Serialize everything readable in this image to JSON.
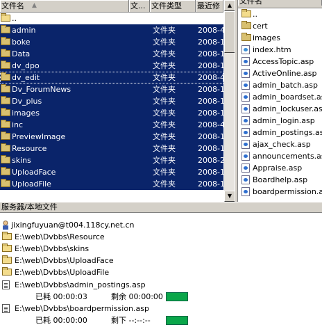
{
  "left_panel": {
    "columns": {
      "name": "文件名",
      "size": "文...",
      "type": "文件类型",
      "modified": "最近修"
    },
    "rows": [
      {
        "name": "..",
        "type": "",
        "date": "",
        "selected": false
      },
      {
        "name": "admin",
        "type": "文件夹",
        "date": "2008-4",
        "selected": true
      },
      {
        "name": "boke",
        "type": "文件夹",
        "date": "2008-1",
        "selected": true
      },
      {
        "name": "Data",
        "type": "文件夹",
        "date": "2008-1",
        "selected": true
      },
      {
        "name": "dv_dpo",
        "type": "文件夹",
        "date": "2008-1",
        "selected": true
      },
      {
        "name": "dv_edit",
        "type": "文件夹",
        "date": "2008-4",
        "selected": true
      },
      {
        "name": "Dv_ForumNews",
        "type": "文件夹",
        "date": "2008-1",
        "selected": true
      },
      {
        "name": "Dv_plus",
        "type": "文件夹",
        "date": "2008-1",
        "selected": true
      },
      {
        "name": "images",
        "type": "文件夹",
        "date": "2008-1",
        "selected": true
      },
      {
        "name": "inc",
        "type": "文件夹",
        "date": "2008-4",
        "selected": true
      },
      {
        "name": "PreviewImage",
        "type": "文件夹",
        "date": "2008-1",
        "selected": true
      },
      {
        "name": "Resource",
        "type": "文件夹",
        "date": "2008-1",
        "selected": true
      },
      {
        "name": "skins",
        "type": "文件夹",
        "date": "2008-2",
        "selected": true
      },
      {
        "name": "UploadFace",
        "type": "文件夹",
        "date": "2008-1",
        "selected": true
      },
      {
        "name": "UploadFile",
        "type": "文件夹",
        "date": "2008-1",
        "selected": true
      }
    ]
  },
  "right_panel": {
    "column": "文件名",
    "items": [
      {
        "name": "..",
        "icon": "parent-folder-icon"
      },
      {
        "name": "cert",
        "icon": "folder-icon"
      },
      {
        "name": "images",
        "icon": "folder-icon"
      },
      {
        "name": "index.htm",
        "icon": "html-file-icon"
      },
      {
        "name": "AccessTopic.asp",
        "icon": "asp-file-icon"
      },
      {
        "name": "ActiveOnline.asp",
        "icon": "asp-file-icon"
      },
      {
        "name": "admin_batch.asp",
        "icon": "asp-file-icon"
      },
      {
        "name": "admin_boardset.asp",
        "icon": "asp-file-icon"
      },
      {
        "name": "admin_lockuser.asp",
        "icon": "asp-file-icon"
      },
      {
        "name": "admin_login.asp",
        "icon": "asp-file-icon"
      },
      {
        "name": "admin_postings.asp",
        "icon": "asp-file-icon"
      },
      {
        "name": "ajax_check.asp",
        "icon": "asp-file-icon"
      },
      {
        "name": "announcements.asp",
        "icon": "asp-file-icon"
      },
      {
        "name": "Appraise.asp",
        "icon": "asp-file-icon"
      },
      {
        "name": "Boardhelp.asp",
        "icon": "asp-file-icon"
      },
      {
        "name": "boardpermission.asp",
        "icon": "asp-file-icon"
      }
    ]
  },
  "queue": {
    "header": "服务器/本地文件",
    "server": "jixingfuyuan@t004.118cy.net.cn",
    "folders": [
      "E:\\web\\Dvbbs\\Resource",
      "E:\\web\\Dvbbs\\skins",
      "E:\\web\\Dvbbs\\UploadFace",
      "E:\\web\\Dvbbs\\UploadFile"
    ],
    "transfers": [
      {
        "file": "E:\\web\\Dvbbs\\admin_postings.asp",
        "elapsed": "已耗 00:00:03",
        "remaining": "剩余 00:00:00",
        "progress": 1.0
      },
      {
        "file": "E:\\web\\Dvbbs\\boardpermission.asp",
        "elapsed": "已耗 00:00:00",
        "remaining": "剩下 --:--:--",
        "progress": 1.0
      }
    ]
  },
  "colors": {
    "selection": "#0a246a",
    "progress": "#0aa64a",
    "chrome": "#d4d0c8"
  }
}
